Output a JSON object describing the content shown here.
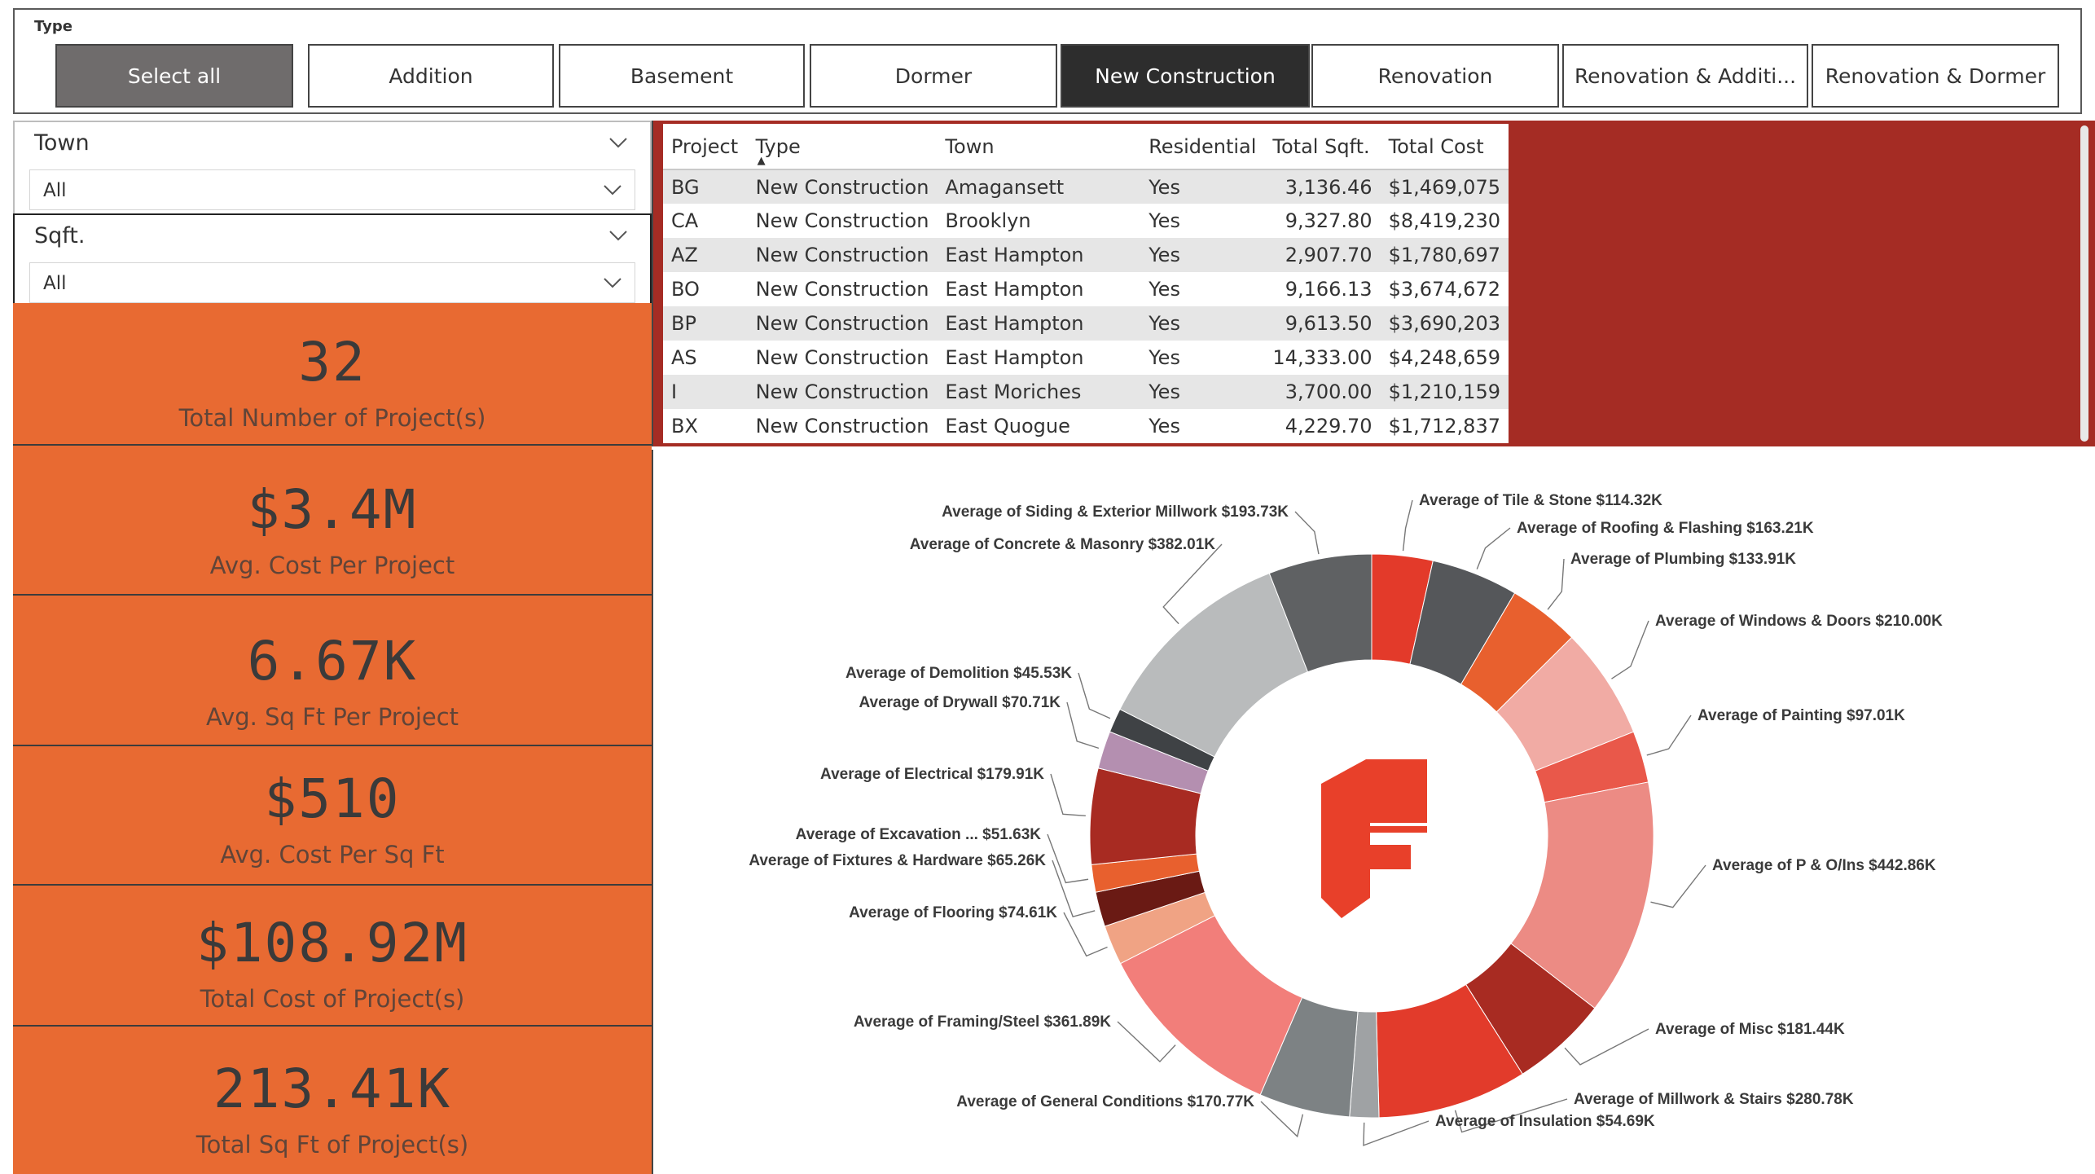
{
  "type_slicer": {
    "title": "Type",
    "options": [
      "Select all",
      "Addition",
      "Basement",
      "Dormer",
      "New Construction",
      "Renovation",
      "Renovation & Additi...",
      "Renovation & Dormer"
    ],
    "selected": "New Construction"
  },
  "filters": {
    "town": {
      "label": "Town",
      "value": "All"
    },
    "sqft": {
      "label": "Sqft.",
      "value": "All"
    }
  },
  "kpis": [
    {
      "value": "32",
      "label": "Total Number of Project(s)"
    },
    {
      "value": "$3.4M",
      "label": "Avg. Cost Per Project"
    },
    {
      "value": "6.67K",
      "label": "Avg. Sq Ft Per Project"
    },
    {
      "value": "$510",
      "label": "Avg. Cost Per Sq Ft"
    },
    {
      "value": "$108.92M",
      "label": "Total Cost of Project(s)"
    },
    {
      "value": "213.41K",
      "label": "Total Sq Ft of Project(s)"
    }
  ],
  "table": {
    "columns": [
      "Project",
      "Type",
      "Town",
      "Residential",
      "Total Sqft.",
      "Total Cost"
    ],
    "rows": [
      [
        "BG",
        "New Construction",
        "Amagansett",
        "Yes",
        "3,136.46",
        "$1,469,075"
      ],
      [
        "CA",
        "New Construction",
        "Brooklyn",
        "Yes",
        "9,327.80",
        "$8,419,230"
      ],
      [
        "AZ",
        "New Construction",
        "East Hampton",
        "Yes",
        "2,907.70",
        "$1,780,697"
      ],
      [
        "BO",
        "New Construction",
        "East Hampton",
        "Yes",
        "9,166.13",
        "$3,674,672"
      ],
      [
        "BP",
        "New Construction",
        "East Hampton",
        "Yes",
        "9,613.50",
        "$3,690,203"
      ],
      [
        "AS",
        "New Construction",
        "East Hampton",
        "Yes",
        "14,333.00",
        "$4,248,659"
      ],
      [
        "I",
        "New Construction",
        "East Moriches",
        "Yes",
        "3,700.00",
        "$1,210,159"
      ],
      [
        "BX",
        "New Construction",
        "East Quogue",
        "Yes",
        "4,229.70",
        "$1,712,837"
      ]
    ]
  },
  "colors": {
    "accent_orange": "#e86a32",
    "table_panel_bg": "#a52c24",
    "active_button": "#2d2d2d",
    "select_all_button": "#6f6c6c",
    "logo_red": "#e8402a"
  },
  "chart_data": {
    "type": "pie",
    "variant": "donut",
    "values_unit": "K",
    "slices": [
      {
        "label": "Average of Tile & Stone $114.32K",
        "value": 114.32,
        "color": "#e33a2a"
      },
      {
        "label": "Average of Roofing & Flashing $163.21K",
        "value": 163.21,
        "color": "#55575a"
      },
      {
        "label": "Average of Plumbing $133.91K",
        "value": 133.91,
        "color": "#e8602e"
      },
      {
        "label": "Average of Windows & Doors $210.00K",
        "value": 210.0,
        "color": "#f1aba4"
      },
      {
        "label": "Average of Painting $97.01K",
        "value": 97.01,
        "color": "#e9584a"
      },
      {
        "label": "Average of P & O/Ins $442.86K",
        "value": 442.86,
        "color": "#ec8b84"
      },
      {
        "label": "Average of Misc $181.44K",
        "value": 181.44,
        "color": "#a82b22"
      },
      {
        "label": "Average of Millwork & Stairs $280.78K",
        "value": 280.78,
        "color": "#e23b2b"
      },
      {
        "label": "Average of Insulation $54.69K",
        "value": 54.69,
        "color": "#9fa2a4"
      },
      {
        "label": "Average of General Conditions $170.77K",
        "value": 170.77,
        "color": "#7d8284"
      },
      {
        "label": "Average of Framing/Steel $361.89K",
        "value": 361.89,
        "color": "#f27e7a"
      },
      {
        "label": "Average of Flooring $74.61K",
        "value": 74.61,
        "color": "#f0a384"
      },
      {
        "label": "Average of Fixtures & Hardware $65.26K",
        "value": 65.26,
        "color": "#6a1a14"
      },
      {
        "label": "Average of Excavation ... $51.63K",
        "value": 51.63,
        "color": "#e8602e"
      },
      {
        "label": "Average of Electrical $179.91K",
        "value": 179.91,
        "color": "#a82b22"
      },
      {
        "label": "Average of Drywall $70.71K",
        "value": 70.71,
        "color": "#b48fb0"
      },
      {
        "label": "Average of Demolition $45.53K",
        "value": 45.53,
        "color": "#3f4245"
      },
      {
        "label": "Average of Concrete & Masonry $382.01K",
        "value": 382.01,
        "color": "#b9bbbc"
      },
      {
        "label": "Average of Siding & Exterior Millwork $193.73K",
        "value": 193.73,
        "color": "#5f6163"
      }
    ]
  }
}
